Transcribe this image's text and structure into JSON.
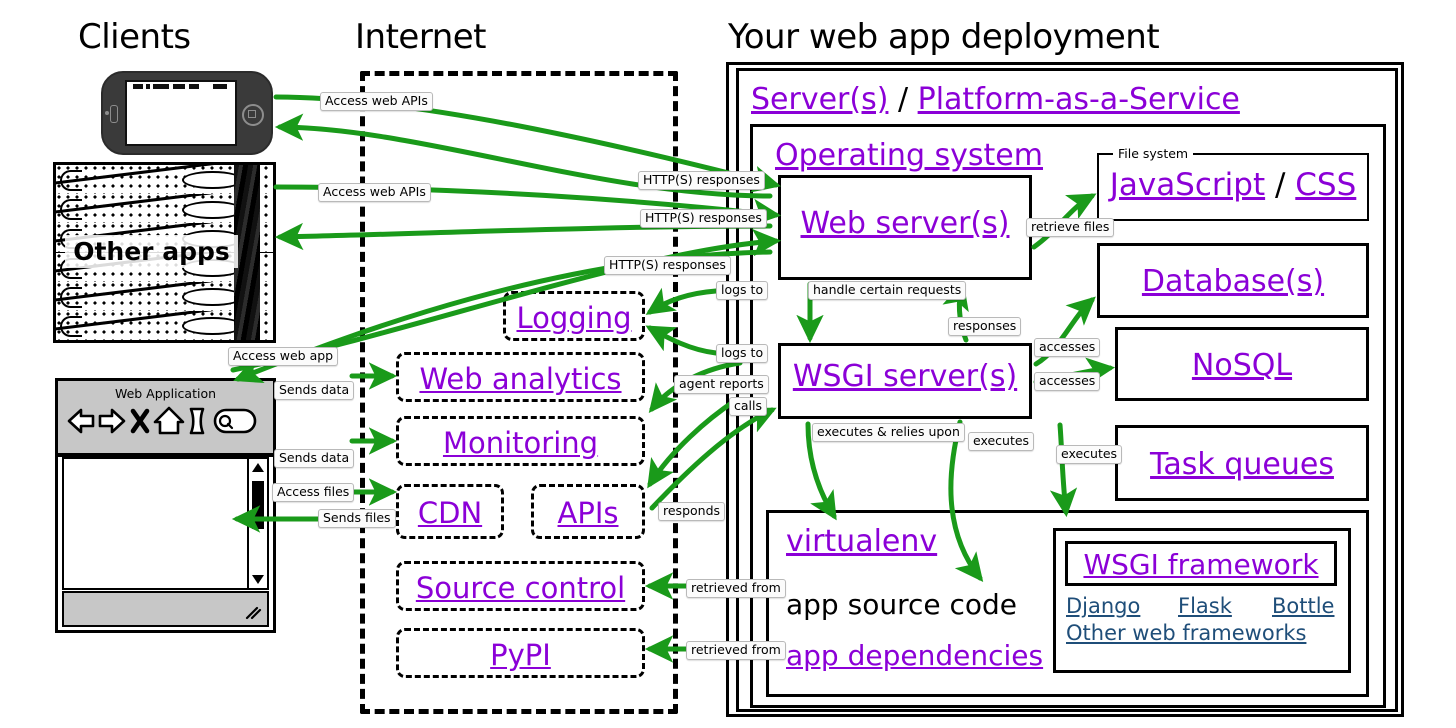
{
  "columns": {
    "clients": "Clients",
    "internet": "Internet",
    "deployment": "Your web app deployment"
  },
  "clients": {
    "phone_label": "phone-device",
    "rack_caption": "Other apps",
    "browser": {
      "title": "Web Application",
      "icons": [
        "back-arrow-icon",
        "forward-arrow-icon",
        "close-x-icon",
        "home-icon",
        "page-icon",
        "search-field-icon"
      ]
    }
  },
  "internet_nodes": [
    {
      "id": "logging",
      "label": "Logging"
    },
    {
      "id": "web-analytics",
      "label": "Web analytics"
    },
    {
      "id": "monitoring",
      "label": "Monitoring"
    },
    {
      "id": "cdn",
      "label": "CDN"
    },
    {
      "id": "apis",
      "label": "APIs"
    },
    {
      "id": "source-control",
      "label": "Source control"
    },
    {
      "id": "pypi",
      "label": "PyPI"
    }
  ],
  "deployment": {
    "server_line": {
      "left": "Server(s)",
      "sep": "/",
      "right": "Platform-as-a-Service"
    },
    "operating_system": "Operating system",
    "web_server": "Web server(s)",
    "wsgi_server": "WSGI server(s)",
    "file_system_legend": "File system",
    "javascript_css": {
      "left": "JavaScript",
      "sep": "/",
      "right": "CSS"
    },
    "database": "Database(s)",
    "nosql": "NoSQL",
    "task_queues": "Task queues",
    "virtualenv": "virtualenv",
    "app_source_code": "app source code",
    "app_dependencies": "app dependencies",
    "wsgi_framework": "WSGI framework",
    "frameworks": [
      "Django",
      "Flask",
      "Bottle"
    ],
    "other_frameworks": "Other web frameworks"
  },
  "edge_labels": {
    "access_web_apis_phone": "Access web APIs",
    "access_web_apis_apps": "Access web APIs",
    "http_responses_1": "HTTP(S) responses",
    "http_responses_2": "HTTP(S) responses",
    "http_responses_3": "HTTP(S) responses",
    "access_web_app": "Access web app",
    "sends_data_1": "Sends data",
    "sends_data_2": "Sends data",
    "access_files": "Access files",
    "sends_files": "Sends files",
    "logs_to_1": "logs to",
    "logs_to_2": "logs to",
    "agent_reports": "agent reports",
    "calls": "calls",
    "responds": "responds",
    "retrieve_files": "retrieve files",
    "handle_certain_requests": "handle certain requests",
    "responses": "responses",
    "accesses_1": "accesses",
    "accesses_2": "accesses",
    "executes_relies": "executes & relies upon",
    "executes_1": "executes",
    "executes_2": "executes",
    "retrieved_from_1": "retrieved from",
    "retrieved_from_2": "retrieved from"
  },
  "colors": {
    "arrow_green": "#1a9a1a",
    "link_purple": "#8B00D7",
    "link_blue": "#1f4e79",
    "outline_black": "#000000",
    "chrome_gray": "#c7c7c7"
  }
}
